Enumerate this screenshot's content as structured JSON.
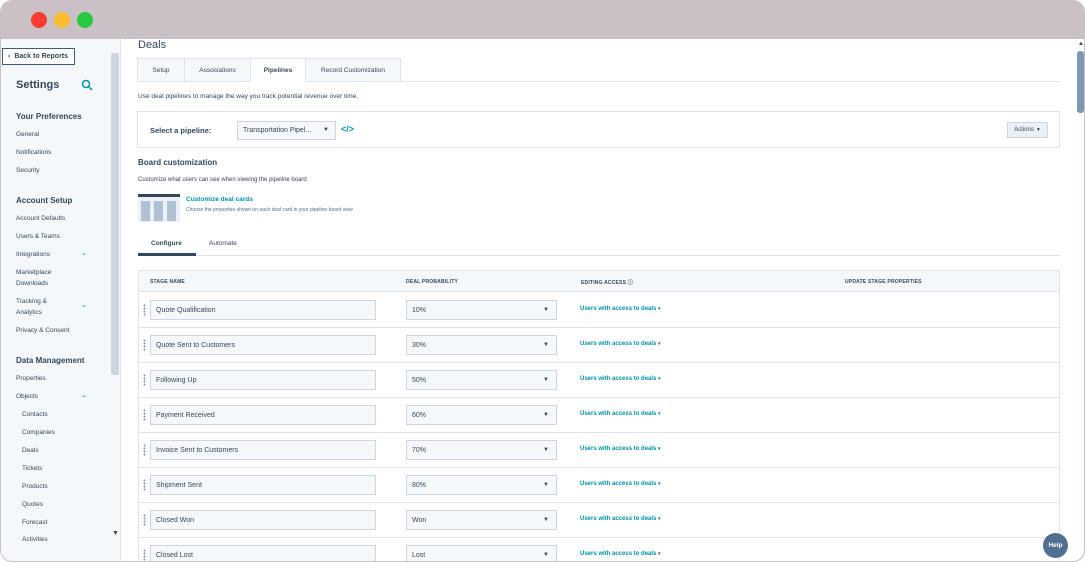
{
  "window": {
    "controls": [
      "close",
      "minimize",
      "maximize"
    ]
  },
  "sidebar": {
    "back_label": "Back to Reports",
    "title": "Settings",
    "sections": [
      {
        "title": "Your Preferences",
        "items": [
          "General",
          "Notifications",
          "Security"
        ]
      },
      {
        "title": "Account Setup",
        "items": [
          "Account Defaults",
          "Users & Teams",
          "Integrations",
          "Marketplace Downloads",
          "Tracking & Analytics",
          "Privacy & Consent"
        ]
      },
      {
        "title": "Data Management",
        "items": [
          "Properties",
          "Objects"
        ],
        "subitems": [
          "Contacts",
          "Companies",
          "Deals",
          "Tickets",
          "Products",
          "Quotes",
          "Forecast",
          "Activities"
        ]
      }
    ],
    "integrations_line1": "Integrations",
    "marketplace_line1": "Marketplace",
    "marketplace_line2": "Downloads",
    "tracking_line1": "Tracking &",
    "tracking_line2": "Analytics"
  },
  "main": {
    "title": "Deals",
    "tabs": [
      {
        "label": "Setup"
      },
      {
        "label": "Associations"
      },
      {
        "label": "Pipelines"
      },
      {
        "label": "Record Customization"
      }
    ],
    "description": "Use deal pipelines to manage the way you track potential revenue over time.",
    "pipeline": {
      "label": "Select a pipeline:",
      "value": "Transportation Pipel...",
      "actions_label": "Actions"
    },
    "board": {
      "title": "Board customization",
      "description": "Customize what users can see when viewing the pipeline board",
      "link": "Customize deal cards",
      "link_desc": "Choose the properties shown on each deal card in your pipeline board view"
    },
    "subtabs": [
      "Configure",
      "Automate"
    ],
    "table": {
      "headers": {
        "stage": "STAGE NAME",
        "prob": "DEAL PROBABILITY",
        "access": "EDITING ACCESS",
        "update": "UPDATE STAGE PROPERTIES"
      },
      "rows": [
        {
          "stage": "Quote Qualification",
          "prob": "10%",
          "access": "Users with access to deals"
        },
        {
          "stage": "Quote Sent to Customers",
          "prob": "30%",
          "access": "Users with access to deals"
        },
        {
          "stage": "Following Up",
          "prob": "50%",
          "access": "Users with access to deals"
        },
        {
          "stage": "Payment Received",
          "prob": "60%",
          "access": "Users with access to deals"
        },
        {
          "stage": "Invoice Sent to Customers",
          "prob": "70%",
          "access": "Users with access to deals"
        },
        {
          "stage": "Shipment Sent",
          "prob": "80%",
          "access": "Users with access to deals"
        },
        {
          "stage": "Closed Won",
          "prob": "Won",
          "access": "Users with access to deals"
        },
        {
          "stage": "Closed Lost",
          "prob": "Lost",
          "access": "Users with access to deals"
        }
      ]
    }
  },
  "help_label": "Help"
}
